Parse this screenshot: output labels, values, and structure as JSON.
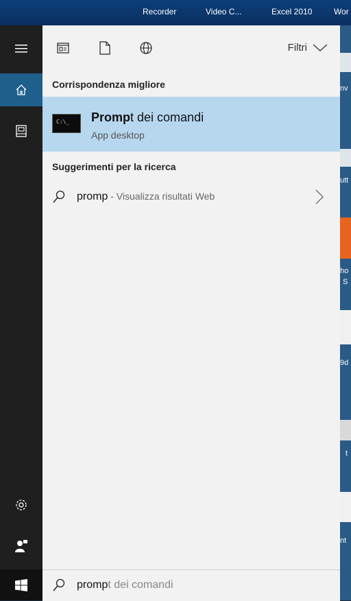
{
  "taskbar": {
    "items": [
      "Recorder",
      "Video C...",
      "Excel 2010",
      "Wor"
    ]
  },
  "rail": {
    "items": [
      {
        "icon": "hamburger-icon"
      },
      {
        "icon": "home-icon",
        "active": true
      },
      {
        "icon": "notebook-icon"
      },
      {
        "icon": "gear-icon"
      },
      {
        "icon": "feedback-icon"
      }
    ]
  },
  "filters": {
    "icons": [
      "apps-filter-icon",
      "documents-filter-icon",
      "web-filter-icon"
    ],
    "label": "Filtri"
  },
  "best_match": {
    "header": "Corrispondenza migliore",
    "icon_text": "C:\\_",
    "title_bold": "Promp",
    "title_rest": "t dei comandi",
    "subtitle": "App desktop"
  },
  "suggestions": {
    "header": "Suggerimenti per la ricerca",
    "items": [
      {
        "bold": "promp",
        "rest": " - Visualizza risultati Web"
      }
    ]
  },
  "search": {
    "typed": "promp",
    "ghost": "t dei comandi"
  },
  "desktop_labels": [
    "nv",
    "utt",
    "ho",
    "S",
    "9d",
    "t",
    "nt"
  ],
  "colors": {
    "accent": "#1f5f8c",
    "highlight": "#b7d7ef",
    "panel": "#f2f2f2",
    "rail": "#1f1f1f"
  }
}
